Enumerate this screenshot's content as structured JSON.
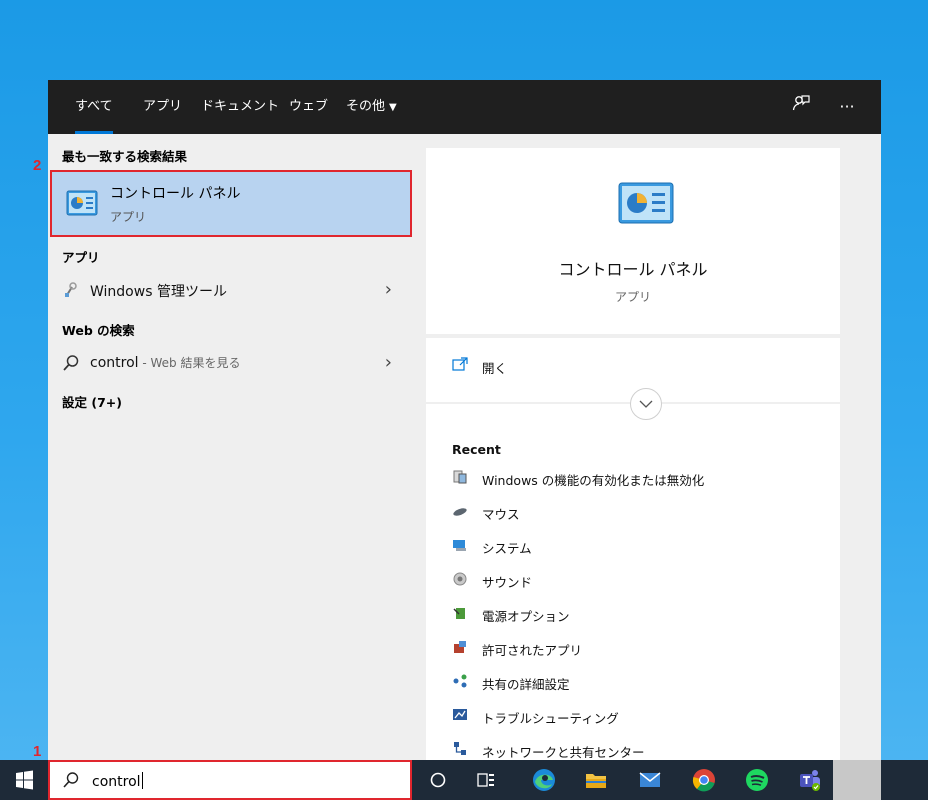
{
  "search_panel": {
    "tabs": [
      {
        "label": "すべて",
        "active": true
      },
      {
        "label": "アプリ"
      },
      {
        "label": "ドキュメント"
      },
      {
        "label": "ウェブ"
      },
      {
        "label": "その他"
      }
    ],
    "topbar_icons": [
      "feedback-icon",
      "more-options-icon"
    ],
    "more_label": "···",
    "left": {
      "best_match_title": "最も一致する検索結果",
      "best_match": {
        "name": "コントロール パネル",
        "type": "アプリ",
        "icon": "control-panel-icon"
      },
      "apps_title": "アプリ",
      "apps": [
        {
          "name": "Windows 管理ツール",
          "icon": "admin-tools-icon"
        }
      ],
      "web_title": "Web の検索",
      "web": {
        "query": "control",
        "suffix": " - Web 結果を見る",
        "icon": "search-icon"
      },
      "settings_title": "設定 (7+)"
    },
    "right": {
      "name": "コントロール パネル",
      "type": "アプリ",
      "open_label": "開く",
      "recent_title": "Recent",
      "recent": [
        {
          "label": "Windows の機能の有効化または無効化",
          "icon": "windows-features-icon"
        },
        {
          "label": "マウス",
          "icon": "mouse-icon"
        },
        {
          "label": "システム",
          "icon": "system-icon"
        },
        {
          "label": "サウンド",
          "icon": "sound-icon"
        },
        {
          "label": "電源オプション",
          "icon": "power-options-icon"
        },
        {
          "label": "許可されたアプリ",
          "icon": "allowed-apps-icon"
        },
        {
          "label": "共有の詳細設定",
          "icon": "sharing-settings-icon"
        },
        {
          "label": "トラブルシューティング",
          "icon": "troubleshooting-icon"
        },
        {
          "label": "ネットワークと共有センター",
          "icon": "network-center-icon"
        }
      ]
    }
  },
  "taskbar": {
    "search_value": "control",
    "apps": [
      "cortana-icon",
      "task-view-icon",
      "edge-icon",
      "file-explorer-icon",
      "mail-icon",
      "chrome-icon",
      "spotify-icon",
      "teams-icon"
    ]
  },
  "annotations": {
    "step1": "1",
    "step2": "2"
  },
  "colors": {
    "accent": "#0078d7",
    "highlight": "#e0262e",
    "selection": "#b8d3f0",
    "topbar": "#1f1f1f",
    "taskbar": "#1e2a38"
  }
}
